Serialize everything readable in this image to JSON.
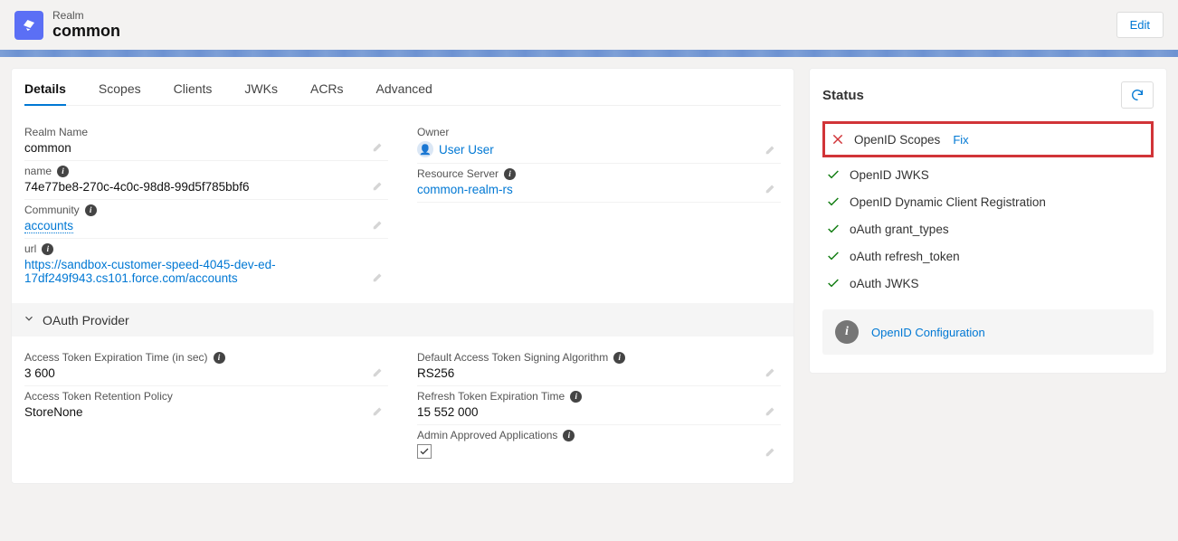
{
  "header": {
    "realm_label": "Realm",
    "realm_name": "common",
    "edit_label": "Edit"
  },
  "tabs": [
    "Details",
    "Scopes",
    "Clients",
    "JWKs",
    "ACRs",
    "Advanced"
  ],
  "active_tab": 0,
  "details": {
    "realm_name_label": "Realm Name",
    "realm_name_value": "common",
    "owner_label": "Owner",
    "owner_value": "User User",
    "name_label": "name",
    "name_value": "74e77be8-270c-4c0c-98d8-99d5f785bbf6",
    "resource_server_label": "Resource Server",
    "resource_server_value": "common-realm-rs",
    "community_label": "Community",
    "community_value": "accounts",
    "url_label": "url",
    "url_value": "https://sandbox-customer-speed-4045-dev-ed-17df249f943.cs101.force.com/accounts"
  },
  "oauth_section_title": "OAuth Provider",
  "oauth": {
    "access_token_exp_label": "Access Token Expiration Time (in sec)",
    "access_token_exp_value": "3 600",
    "default_alg_label": "Default Access Token Signing Algorithm",
    "default_alg_value": "RS256",
    "retention_label": "Access Token Retention Policy",
    "retention_value": "StoreNone",
    "refresh_exp_label": "Refresh Token Expiration Time",
    "refresh_exp_value": "15 552 000",
    "admin_approved_label": "Admin Approved Applications",
    "admin_approved_checked": true
  },
  "status": {
    "title": "Status",
    "items": [
      {
        "ok": false,
        "label": "OpenID Scopes",
        "fix": "Fix",
        "highlight": true
      },
      {
        "ok": true,
        "label": "OpenID JWKS"
      },
      {
        "ok": true,
        "label": "OpenID Dynamic Client Registration"
      },
      {
        "ok": true,
        "label": "oAuth grant_types"
      },
      {
        "ok": true,
        "label": "oAuth refresh_token"
      },
      {
        "ok": true,
        "label": "oAuth JWKS"
      }
    ],
    "config_link": "OpenID Configuration"
  }
}
